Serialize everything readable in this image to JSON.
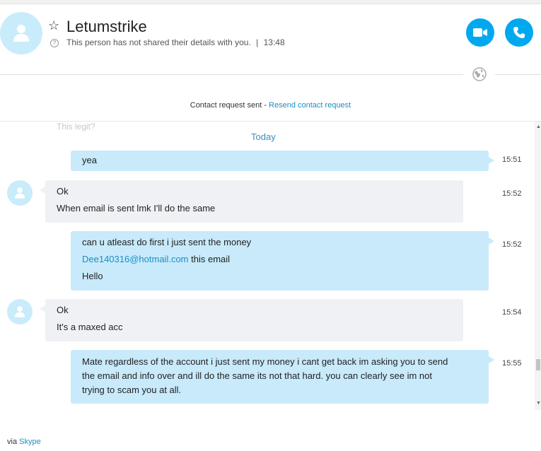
{
  "header": {
    "name": "Letumstrike",
    "status": "This person has not shared their details with you.",
    "separator": "|",
    "time": "13:48",
    "colors": {
      "accent": "#00a8f0",
      "avatar_bg": "#c9ecfb"
    }
  },
  "contact_request": {
    "sent_text": "Contact request sent",
    "dash": " - ",
    "resend_text": "Resend contact request"
  },
  "chat": {
    "ghost_text": "This legit?",
    "date_divider": "Today",
    "messages": [
      {
        "direction": "outgoing",
        "lines": [
          "yea"
        ],
        "time": "15:51"
      },
      {
        "direction": "incoming",
        "lines": [
          "Ok",
          "When email is sent lmk I'll do the same"
        ],
        "time": "15:52"
      },
      {
        "direction": "outgoing",
        "lines": [
          "can u atleast do first i just sent the money"
        ],
        "link": "Dee140316@hotmail.com",
        "link_suffix": " this email",
        "last_line": "Hello",
        "time": "15:52"
      },
      {
        "direction": "incoming",
        "lines": [
          "Ok",
          "It's a maxed acc"
        ],
        "time": "15:54"
      },
      {
        "direction": "outgoing",
        "lines": [
          "Mate regardless of the account i just sent my money i cant get back im asking you to send",
          "the email and info over and ill do the same its not that hard. you can clearly see im not",
          "trying to scam you at all."
        ],
        "time": "15:55"
      }
    ]
  },
  "footer": {
    "via": "via",
    "skype": "Skype"
  },
  "icons": [
    "person-icon",
    "star-icon",
    "question-icon",
    "video-call-icon",
    "phone-icon",
    "globe-icon"
  ]
}
